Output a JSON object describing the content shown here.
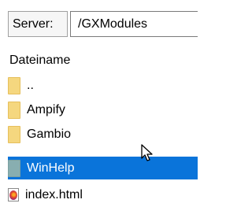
{
  "toolbar": {
    "server_label": "Server:",
    "path_value": "/GXModules"
  },
  "list": {
    "column_header": "Dateiname",
    "items": [
      {
        "label": "..",
        "icon": "folder-icon"
      },
      {
        "label": "Ampify",
        "icon": "folder-icon"
      },
      {
        "label": "Gambio",
        "icon": "folder-icon"
      },
      {
        "label": "WinHelp",
        "icon": "folder-icon",
        "selected": true
      },
      {
        "label": "index.html",
        "icon": "html-file-icon"
      }
    ]
  },
  "colors": {
    "selection": "#0a74da",
    "folder": "#f5d77f",
    "selected_folder": "#88aeb0"
  }
}
